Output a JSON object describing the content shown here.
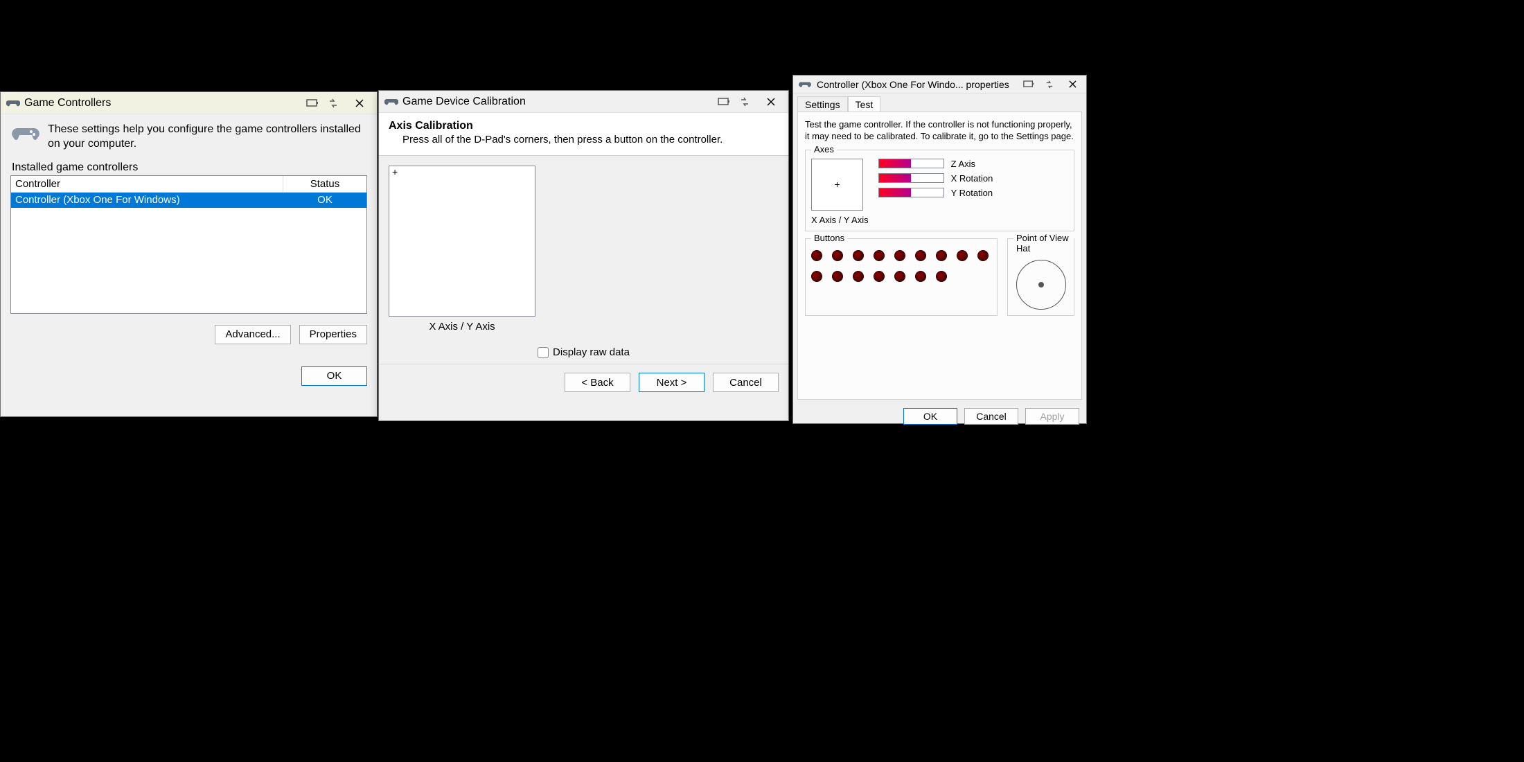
{
  "colors": {
    "selection": "#0078d7",
    "bar_gradient_from": "#ff0020",
    "bar_gradient_to": "#b40090"
  },
  "win1": {
    "title": "Game Controllers",
    "intro": "These settings help you configure the game controllers installed on your computer.",
    "section_label": "Installed game controllers",
    "columns": {
      "controller": "Controller",
      "status": "Status"
    },
    "rows": [
      {
        "name": "Controller (Xbox One For Windows)",
        "status": "OK",
        "selected": true
      }
    ],
    "buttons": {
      "advanced": "Advanced...",
      "properties": "Properties",
      "ok": "OK"
    }
  },
  "win2": {
    "title": "Game Device Calibration",
    "section_title": "Axis Calibration",
    "section_sub": "Press all of the D-Pad's corners, then press a button on the controller.",
    "axis_box_marker": "+",
    "axis_label": "X Axis / Y Axis",
    "raw_checkbox": "Display raw data",
    "buttons": {
      "back": "< Back",
      "next": "Next >",
      "cancel": "Cancel"
    }
  },
  "win3": {
    "title": "Controller (Xbox One For Windo... properties",
    "tabs": {
      "settings": "Settings",
      "test": "Test",
      "active": "Test"
    },
    "desc": "Test the game controller.  If the controller is not functioning properly, it may need to be calibrated.  To calibrate it, go to the Settings page.",
    "axes": {
      "legend": "Axes",
      "xy_marker": "+",
      "xy_label": "X Axis / Y Axis",
      "bars": [
        {
          "label": "Z Axis",
          "percent": 50
        },
        {
          "label": "X Rotation",
          "percent": 50
        },
        {
          "label": "Y Rotation",
          "percent": 50
        }
      ]
    },
    "buttons_group": {
      "legend": "Buttons",
      "count": 16
    },
    "pov_group": {
      "legend": "Point of View Hat"
    },
    "buttons": {
      "ok": "OK",
      "cancel": "Cancel",
      "apply": "Apply"
    }
  }
}
